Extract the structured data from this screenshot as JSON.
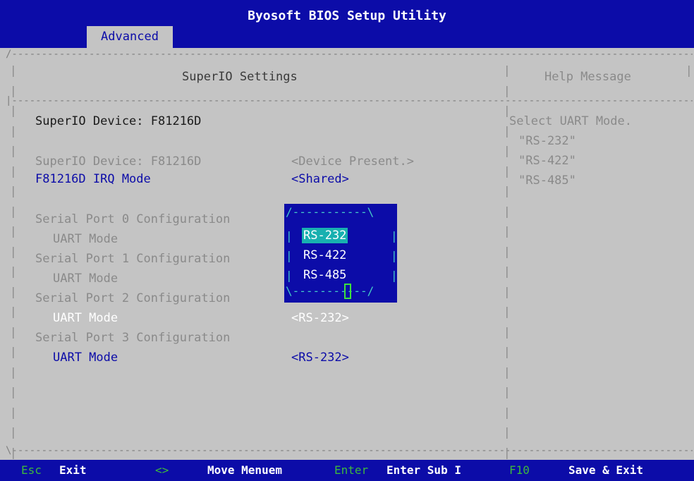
{
  "app_title": "Byosoft BIOS Setup Utility",
  "tabs": [
    {
      "label": "Advanced",
      "active": true
    }
  ],
  "panel": {
    "title": "SuperIO Settings",
    "device_heading": "SuperIO Device: F81216D",
    "rows": [
      {
        "label": "SuperIO Device: F81216D",
        "value": "<Device Present.>",
        "style": "gray"
      },
      {
        "label": "F81216D IRQ Mode",
        "value": "<Shared>",
        "style": "blue"
      },
      {
        "label": "Serial Port 0 Configuration",
        "style": "gray"
      },
      {
        "label": "UART Mode",
        "style": "gray"
      },
      {
        "label": "Serial Port 1 Configuration",
        "style": "gray"
      },
      {
        "label": "UART Mode",
        "style": "gray"
      },
      {
        "label": "Serial Port 2 Configuration",
        "style": "gray"
      },
      {
        "label": "UART Mode",
        "value": "<RS-232>",
        "style": "selected"
      },
      {
        "label": "Serial Port 3 Configuration",
        "style": "gray"
      },
      {
        "label": "UART Mode",
        "value": "<RS-232>",
        "style": "blue"
      }
    ]
  },
  "popup": {
    "options": [
      "RS-232",
      "RS-422",
      "RS-485"
    ],
    "selected": "RS-232"
  },
  "help": {
    "title": "Help Message",
    "lines": [
      "Select UART Mode.",
      "\"RS-232\"",
      "\"RS-422\"",
      "\"RS-485\""
    ]
  },
  "footer": [
    {
      "key": "Esc",
      "action": "Exit"
    },
    {
      "key": "<>",
      "action": "Move Menuem"
    },
    {
      "key": "Enter",
      "action": "Enter Sub I"
    },
    {
      "key": "F10",
      "action": "Save & Exit"
    }
  ],
  "colors": {
    "bios_blue": "#0c0ca8",
    "background": "#c4c4c4",
    "key_green": "#3db83d",
    "popup_highlight": "#18b0b0"
  }
}
